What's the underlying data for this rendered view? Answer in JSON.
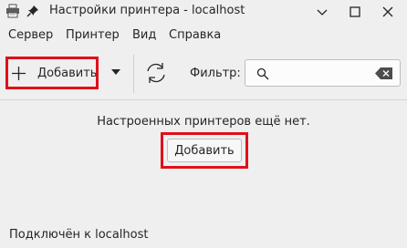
{
  "window": {
    "title": "Настройки принтера - localhost",
    "app_icon": "printer-icon",
    "pin_icon": "pin-icon",
    "controls": [
      "minimize-icon",
      "maximize-icon",
      "close-icon"
    ]
  },
  "menu": {
    "items": [
      {
        "label": "Сервер"
      },
      {
        "label": "Принтер"
      },
      {
        "label": "Вид"
      },
      {
        "label": "Справка"
      }
    ]
  },
  "toolbar": {
    "add_label": "Добавить",
    "add_icon": "plus-icon",
    "dropdown_icon": "triangle-down-icon",
    "refresh_icon": "refresh-icon",
    "filter_label": "Фильтр:",
    "filter_value": "",
    "search_icon": "search-icon",
    "clear_icon": "clear-text-icon"
  },
  "main": {
    "empty_message": "Настроенных принтеров ещё нет.",
    "add_button_label": "Добавить"
  },
  "status": {
    "text": "Подключён к localhost"
  },
  "colors": {
    "highlight": "#e0101b",
    "background": "#efefef",
    "text": "#232627"
  }
}
